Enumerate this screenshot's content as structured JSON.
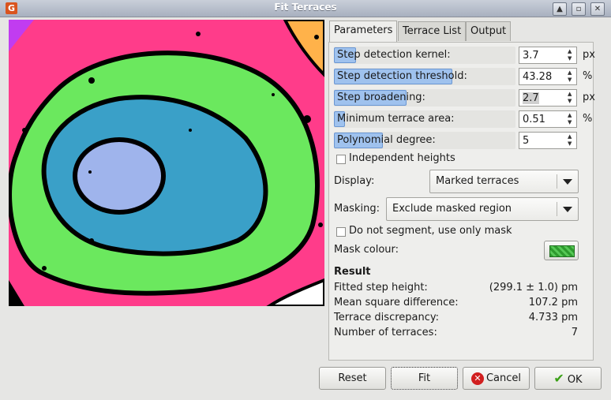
{
  "window": {
    "title": "Fit Terraces",
    "app_icon": "gwyddion-icon"
  },
  "tabs": [
    {
      "label": "Parameters",
      "active": true
    },
    {
      "label": "Terrace List",
      "active": false
    },
    {
      "label": "Output",
      "active": false
    }
  ],
  "params": [
    {
      "label": "Step detection kernel:",
      "value": "3.7",
      "unit": "px",
      "fill": 0.12
    },
    {
      "label": "Step detection threshold:",
      "value": "43.28",
      "unit": "%",
      "fill": 0.65
    },
    {
      "label": "Step broadening:",
      "value": "2.7",
      "unit": "px",
      "fill": 0.4
    },
    {
      "label": "Minimum terrace area:",
      "value": "0.51",
      "unit": "%",
      "fill": 0.06
    },
    {
      "label": "Polynomial degree:",
      "value": "5",
      "unit": "",
      "fill": 0.27
    }
  ],
  "independent_heights": {
    "label": "Independent heights",
    "checked": false
  },
  "display": {
    "label": "Display:",
    "value": "Marked terraces"
  },
  "masking": {
    "label": "Masking:",
    "value": "Exclude masked region"
  },
  "do_not_segment": {
    "label": "Do not segment, use only mask",
    "checked": false
  },
  "mask_colour": {
    "label": "Mask colour:",
    "color": "#2e9b2e"
  },
  "result": {
    "heading": "Result",
    "rows": [
      {
        "label": "Fitted step height:",
        "value": "(299.1 ± 1.0) pm"
      },
      {
        "label": "Mean square difference:",
        "value": "107.2 pm"
      },
      {
        "label": "Terrace discrepancy:",
        "value": "4.733 pm"
      },
      {
        "label": "Number of terraces:",
        "value": "7"
      }
    ]
  },
  "buttons": {
    "reset": "Reset",
    "fit": "Fit",
    "cancel": "Cancel",
    "ok": "OK"
  },
  "colors": {
    "pink": "#ff3c8a",
    "green": "#6be85e",
    "blue": "#3aa0c8",
    "lavender": "#9fb4ec",
    "purple": "#c13cf0",
    "orange": "#ffb24a",
    "white": "#ffffff"
  }
}
